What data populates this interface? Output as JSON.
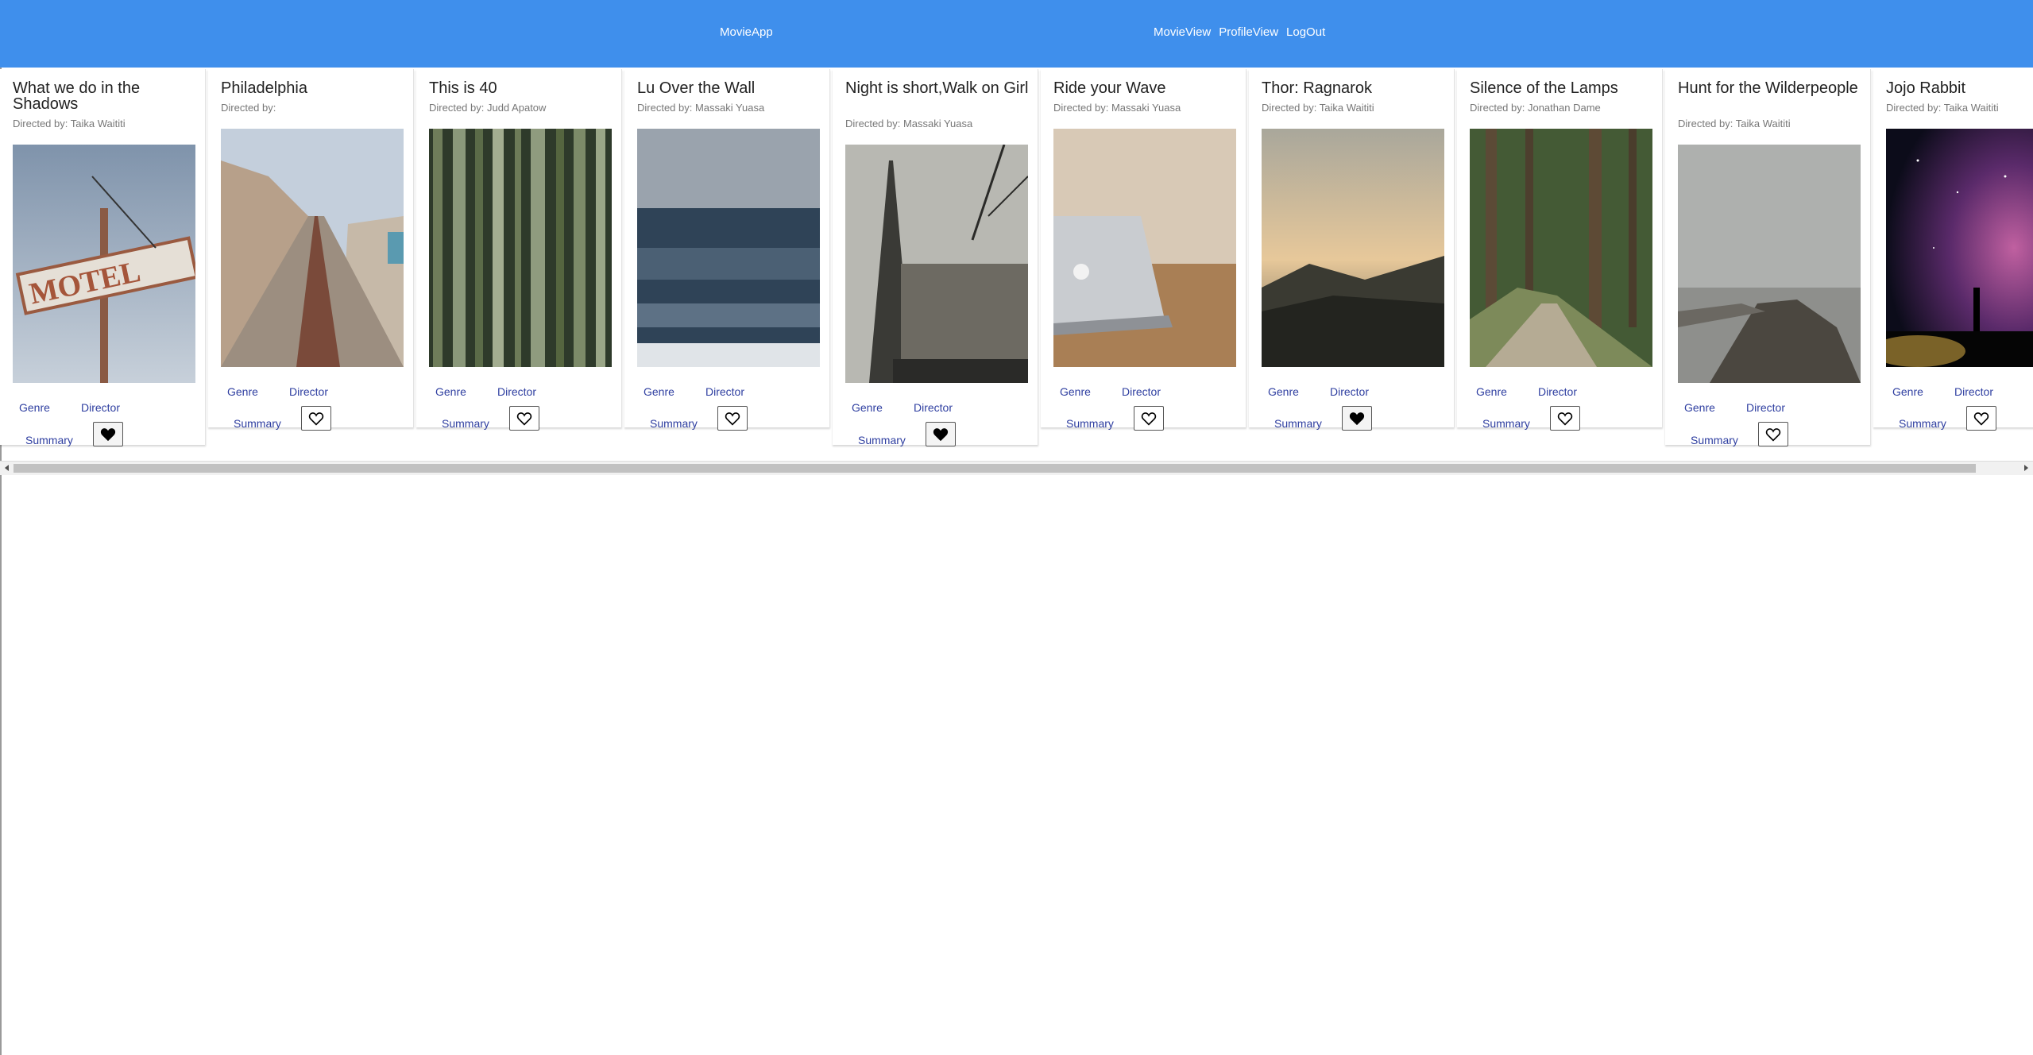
{
  "navbar": {
    "brand": "MovieApp",
    "links": [
      "MovieView",
      "ProfileView",
      "LogOut"
    ],
    "color": "#3f8fec"
  },
  "card_actions": {
    "genre": "Genre",
    "director": "Director",
    "summary": "Summary"
  },
  "movies": [
    {
      "title": "What we do in the Shadows",
      "director_line": "Directed by: Taika Waititi",
      "favorite": true
    },
    {
      "title": "Philadelphia",
      "director_line": "Directed by:",
      "favorite": false
    },
    {
      "title": "This is 40",
      "director_line": "Directed by: Judd Apatow",
      "favorite": false
    },
    {
      "title": "Lu Over the Wall",
      "director_line": "Directed by: Massaki Yuasa",
      "favorite": false
    },
    {
      "title": "Night is short,Walk on Girl",
      "director_line": "Directed by: Massaki Yuasa",
      "favorite": true
    },
    {
      "title": "Ride your Wave",
      "director_line": "Directed by: Massaki Yuasa",
      "favorite": false
    },
    {
      "title": "Thor: Ragnarok",
      "director_line": "Directed by: Taika Waititi",
      "favorite": true
    },
    {
      "title": "Silence of the Lamps",
      "director_line": "Directed by: Jonathan Dame",
      "favorite": false
    },
    {
      "title": "Hunt for the Wilderpeople",
      "director_line": "Directed by: Taika Waititi",
      "favorite": false
    },
    {
      "title": "Jojo Rabbit",
      "director_line": "Directed by: Taika Waititi",
      "favorite": false
    }
  ],
  "posters": [
    {
      "description": "motel-sign-photo"
    },
    {
      "description": "railway-tracks-photo"
    },
    {
      "description": "bamboo-forest-photo"
    },
    {
      "description": "ocean-waves-photo"
    },
    {
      "description": "eiffel-tower-photo"
    },
    {
      "description": "laptop-desk-photo"
    },
    {
      "description": "sunset-mountain-photo"
    },
    {
      "description": "forest-path-photo"
    },
    {
      "description": "foggy-pier-photo"
    },
    {
      "description": "starry-night-photo"
    }
  ]
}
